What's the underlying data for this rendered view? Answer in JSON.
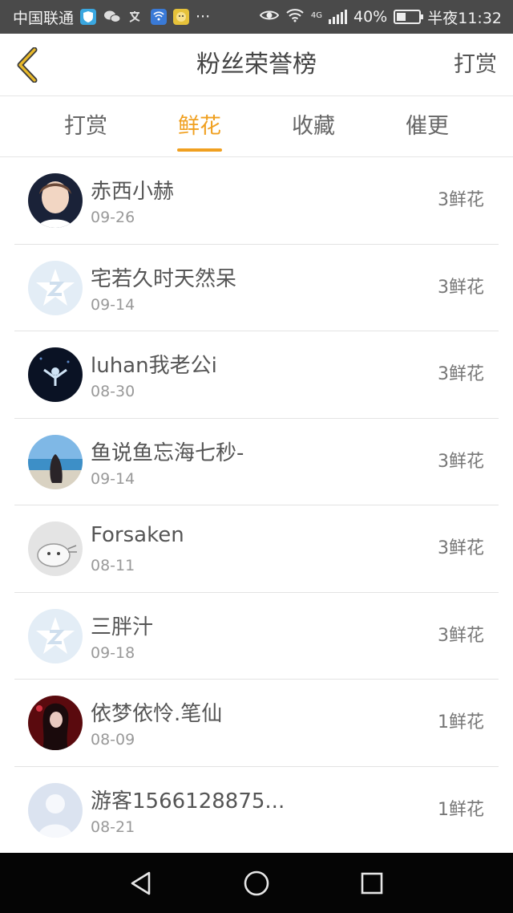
{
  "status_bar": {
    "carrier": "中国联通",
    "network": "4G",
    "battery": "40%",
    "battery_level": 0.4,
    "time": "半夜11:32",
    "more": "···"
  },
  "nav": {
    "title": "粉丝荣誉榜",
    "action": "打赏",
    "back_icon": "chevron-left-icon",
    "accent_color": "#f0a020"
  },
  "tabs": [
    {
      "label": "打赏",
      "active": false
    },
    {
      "label": "鲜花",
      "active": true
    },
    {
      "label": "收藏",
      "active": false
    },
    {
      "label": "催更",
      "active": false
    }
  ],
  "fans": [
    {
      "name": "赤西小赫",
      "date": "09-26",
      "count": "3鲜花",
      "avatar": "photo-boy"
    },
    {
      "name": "宅若久时天然呆",
      "date": "09-14",
      "count": "3鲜花",
      "avatar": "default-star"
    },
    {
      "name": "luhan我老公i",
      "date": "08-30",
      "count": "3鲜花",
      "avatar": "photo-concert"
    },
    {
      "name": "鱼说鱼忘海七秒-",
      "date": "09-14",
      "count": "3鲜花",
      "avatar": "photo-beach"
    },
    {
      "name": "Forsaken",
      "date": "08-11",
      "count": "3鲜花",
      "avatar": "photo-cat"
    },
    {
      "name": "三胖汁",
      "date": "09-18",
      "count": "3鲜花",
      "avatar": "default-star"
    },
    {
      "name": "依梦依怜.笔仙",
      "date": "08-09",
      "count": "1鲜花",
      "avatar": "photo-girl-red"
    },
    {
      "name": "游客1566128875...",
      "date": "08-21",
      "count": "1鲜花",
      "avatar": "default-person"
    }
  ],
  "system_nav": [
    "back-triangle-icon",
    "home-circle-icon",
    "recents-square-icon"
  ]
}
